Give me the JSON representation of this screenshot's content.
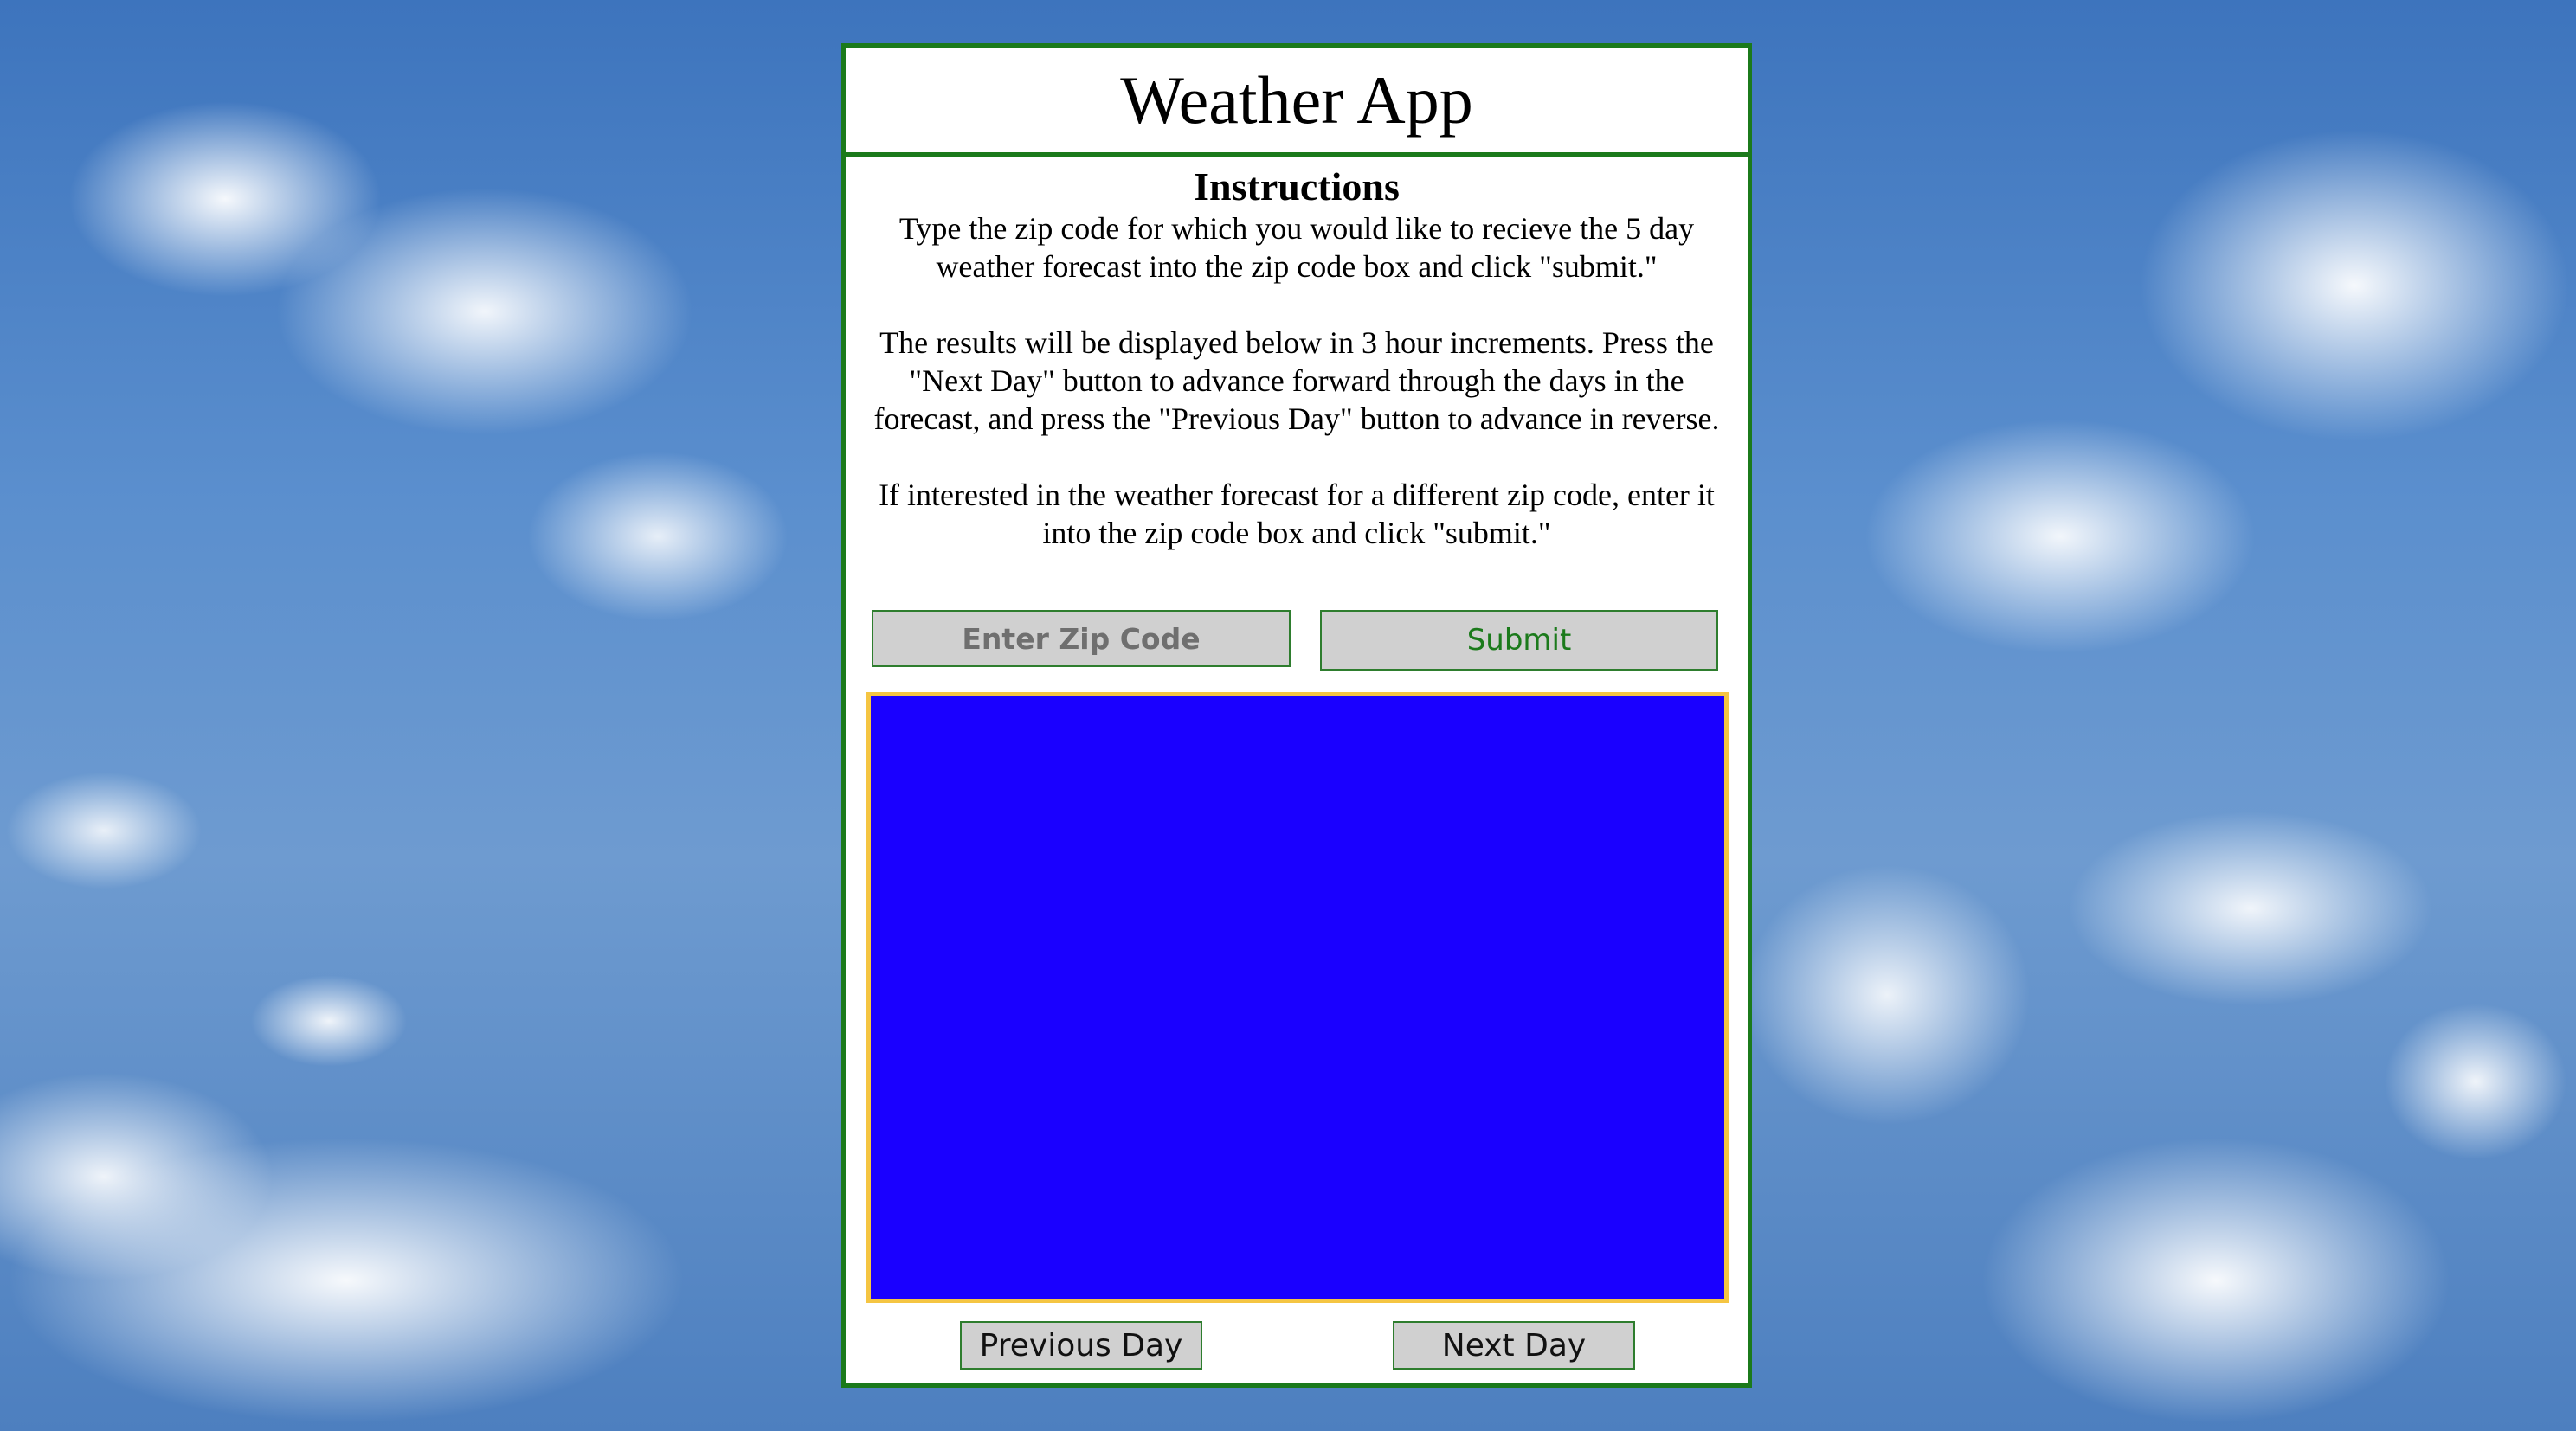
{
  "app": {
    "title": "Weather App"
  },
  "instructions": {
    "heading": "Instructions",
    "paragraphs": [
      "Type the zip code for which you would like to recieve the 5 day weather forecast into the zip code box and click \"submit.\"",
      "The results will be displayed below in 3 hour increments. Press the \"Next Day\" button to advance forward through the days in the forecast, and press the \"Previous Day\" button to advance in reverse.",
      "If interested in the weather forecast for a different zip code, enter it into the zip code box and click \"submit.\""
    ]
  },
  "form": {
    "zip_placeholder": "Enter Zip Code",
    "zip_value": "",
    "submit_label": "Submit"
  },
  "navigation": {
    "previous_label": "Previous Day",
    "next_label": "Next Day"
  },
  "colors": {
    "panel_border": "#1b7a1b",
    "results_background": "#1a00ff",
    "results_border": "#f5c542",
    "button_background": "#d0d0d0",
    "submit_text": "#1b7a1b"
  }
}
